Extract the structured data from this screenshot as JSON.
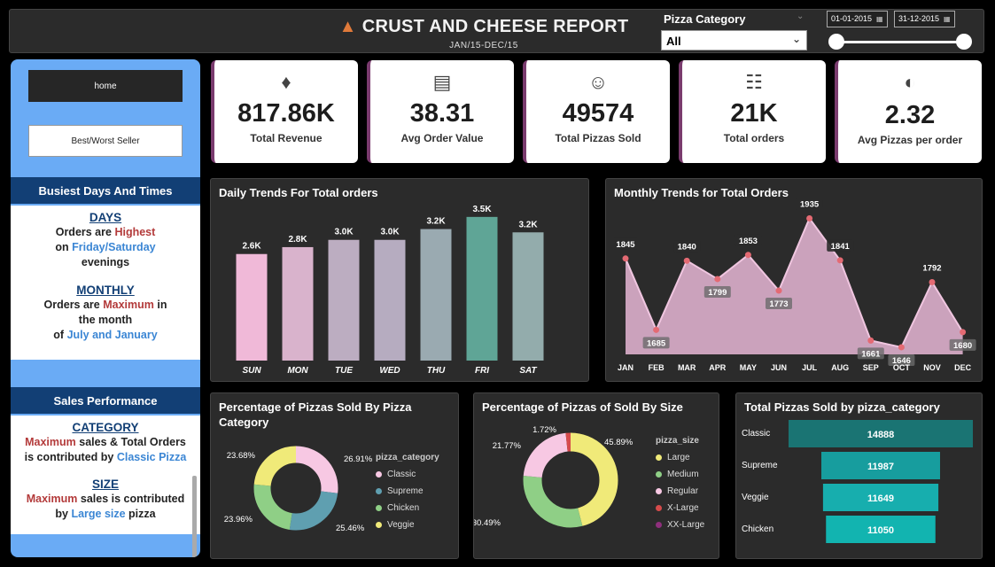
{
  "header": {
    "title": "CRUST AND CHEESE REPORT",
    "subtitle": "JAN/15-DEC/15",
    "logo_icon": "pizza-slice-icon",
    "slicer_label": "Pizza Category",
    "slicer_value": "All",
    "date_start": "01-01-2015",
    "date_end": "31-12-2015"
  },
  "sidebar": {
    "home_label": "home",
    "best_worst_label": "Best/Worst Seller",
    "busiest": {
      "title": "Busiest Days And Times",
      "days_heading": "DAYS",
      "days_t1": "Orders are ",
      "days_hl1": "Highest",
      "days_t2": "on ",
      "days_hl2": "Friday/Saturday",
      "days_t3": "evenings",
      "monthly_heading": "MONTHLY",
      "monthly_t1": "Orders are ",
      "monthly_hl1": "Maximum",
      "monthly_t2": " in",
      "monthly_t3": "the month",
      "monthly_t4": "of ",
      "monthly_hl2": "July and January"
    },
    "sales": {
      "title": "Sales Performance",
      "category_heading": "CATEGORY",
      "cat_hl1": "Maximum",
      "cat_t1": " sales & Total Orders",
      "cat_t2": "is contributed by ",
      "cat_hl2": "Classic Pizza",
      "size_heading": "SIZE",
      "size_hl1": "Maximum",
      "size_t1": " sales is contributed",
      "size_t2": "by ",
      "size_hl2": "Large size",
      "size_t3": " pizza"
    }
  },
  "kpis": [
    {
      "icon": "money-bag-icon",
      "value": "817.86K",
      "label": "Total Revenue"
    },
    {
      "icon": "receipt-icon",
      "value": "38.31",
      "label": "Avg Order Value"
    },
    {
      "icon": "delivery-person-icon",
      "value": "49574",
      "label": "Total Pizzas Sold"
    },
    {
      "icon": "clipboard-icon",
      "value": "21K",
      "label": "Total orders"
    },
    {
      "icon": "pizza-icon",
      "value": "2.32",
      "label": "Avg Pizzas per order"
    }
  ],
  "chart_data": [
    {
      "type": "bar",
      "title": "Daily Trends For Total orders",
      "categories": [
        "SUN",
        "MON",
        "TUE",
        "WED",
        "THU",
        "FRI",
        "SAT"
      ],
      "values": [
        2624,
        2794,
        2973,
        2973,
        3239,
        3538,
        3158
      ],
      "data_labels": [
        "2.6K",
        "2.8K",
        "3.0K",
        "3.0K",
        "3.2K",
        "3.5K",
        "3.2K"
      ],
      "colors": [
        "#f0b9d8",
        "#d9b3cc",
        "#bcadc1",
        "#b6acc0",
        "#9aaab1",
        "#5fa596",
        "#93acac"
      ],
      "ylim": [
        0,
        3600
      ]
    },
    {
      "type": "area",
      "title": "Monthly Trends for Total Orders",
      "categories": [
        "JAN",
        "FEB",
        "MAR",
        "APR",
        "MAY",
        "JUN",
        "JUL",
        "AUG",
        "SEP",
        "OCT",
        "NOV",
        "DEC"
      ],
      "values": [
        1845,
        1685,
        1840,
        1799,
        1853,
        1773,
        1935,
        1841,
        1661,
        1646,
        1792,
        1680
      ],
      "ylim": [
        1630,
        1940
      ],
      "color": "#e8b7d6"
    },
    {
      "type": "pie",
      "title": "Percentage of Pizzas Sold By Pizza Category",
      "legend_title": "pizza_category",
      "labels": [
        "Classic",
        "Supreme",
        "Chicken",
        "Veggie"
      ],
      "values": [
        26.91,
        25.46,
        23.96,
        23.68
      ],
      "value_labels": [
        "26.91%",
        "25.46%",
        "23.96%",
        "23.68%"
      ],
      "colors": [
        "#f7c8e3",
        "#5f9fb0",
        "#8fcf86",
        "#f0ea79"
      ]
    },
    {
      "type": "pie",
      "title": "Percentage of Pizzas of Sold By Size",
      "legend_title": "pizza_size",
      "labels": [
        "Large",
        "Medium",
        "Regular",
        "X-Large",
        "XX-Large"
      ],
      "values": [
        45.89,
        30.49,
        21.77,
        1.72,
        0.12
      ],
      "value_labels": [
        "45.89%",
        "30.49%",
        "21.77%",
        "1.72%",
        ""
      ],
      "colors": [
        "#f0ea79",
        "#8fcf86",
        "#f7c8e3",
        "#d64b4b",
        "#8e2f7c"
      ]
    },
    {
      "type": "bar",
      "orientation": "horizontal",
      "title": "Total Pizzas Sold by pizza_category",
      "categories": [
        "Classic",
        "Supreme",
        "Veggie",
        "Chicken"
      ],
      "values": [
        14888,
        11987,
        11649,
        11050
      ],
      "colors": [
        "#1a7473",
        "#179d9e",
        "#17aeae",
        "#12b4b0"
      ],
      "xlim": [
        0,
        14888
      ]
    }
  ]
}
